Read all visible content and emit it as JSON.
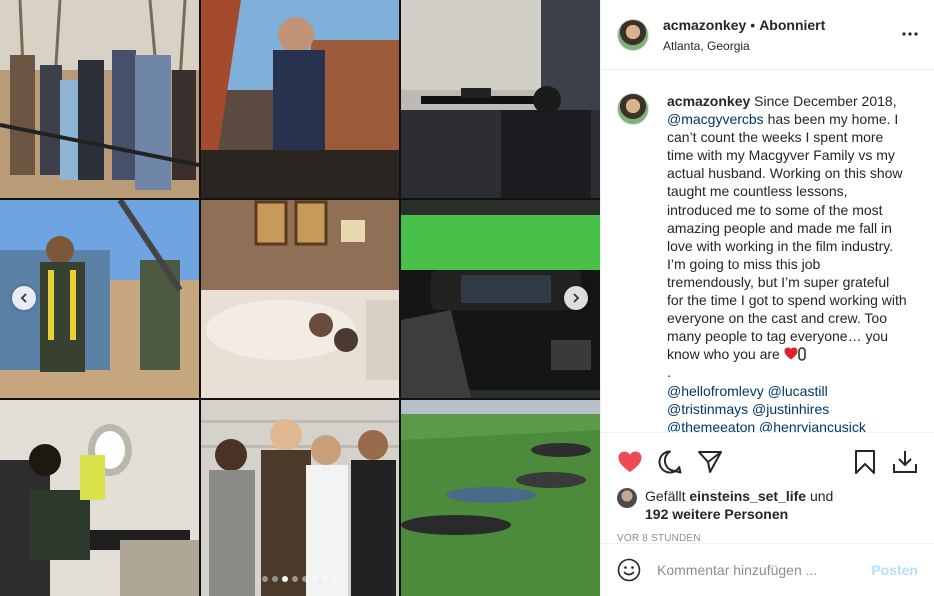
{
  "post": {
    "username": "acmazonkey",
    "follow_state": "Abonniert",
    "location": "Atlanta, Georgia",
    "separator": "•"
  },
  "caption": {
    "username": "acmazonkey",
    "text_1": " Since December 2018, ",
    "mention_main": "@macgyvercbs",
    "text_2": " has been my home. I can’t count the weeks I spent more time with my Macgyver Family vs my actual husband. Working on this show taught me countless lessons, introduced me to some of the most amazing people and made me fall in love with working in the film industry. I’m going to miss this job tremendously, but I’m super grateful for the time I got to spend working with everyone on the cast and crew. Too many people to tag everyone… you know who you are ",
    "dot_line": ".",
    "tags_line_1a": "@hellofromlevy",
    "tags_line_1b": "@lucastill",
    "tags_line_2a": "@tristinmays",
    "tags_line_2b": "@justinhires",
    "tags_line_3a": "@themeeaton",
    "tags_line_3b": "@henryiancusick"
  },
  "likes": {
    "prefix": "Gefällt ",
    "user": "einsteins_set_life",
    "mid": " und",
    "count_text": "192 weitere Personen"
  },
  "timestamp": "VOR 8 STUNDEN",
  "comment_input": {
    "placeholder": "Kommentar hinzufügen ...",
    "post_label": "Posten"
  },
  "icons": {
    "like": "heart-filled-icon",
    "comment": "comment-icon",
    "share": "share-icon",
    "save": "bookmark-icon",
    "download": "download-icon",
    "more": "more-icon",
    "emoji": "emoji-icon",
    "prev": "chevron-left-icon",
    "next": "chevron-right-icon"
  },
  "colors": {
    "like_red": "#ed4956",
    "mention": "#00376b",
    "post_disabled": "#b2dffc"
  },
  "carousel": {
    "slide_count": 8,
    "active_index": 2
  }
}
